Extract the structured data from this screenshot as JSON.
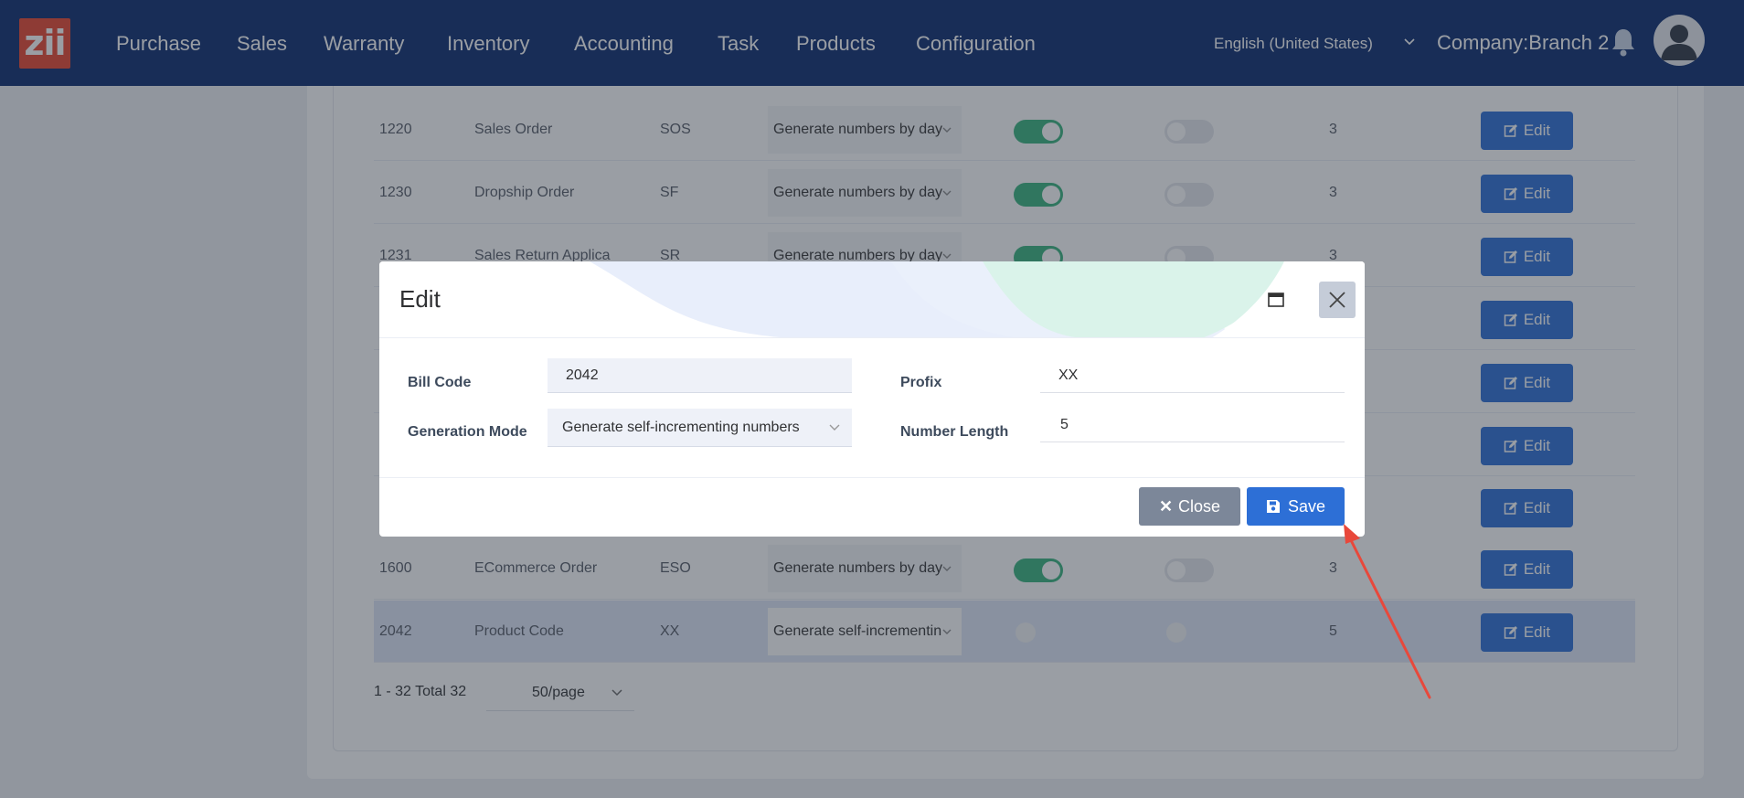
{
  "navbar": {
    "logo_text": "zii",
    "items": [
      "Purchase",
      "Sales",
      "Warranty",
      "Inventory",
      "Accounting",
      "Task",
      "Products",
      "Configuration"
    ],
    "language": "English (United States)",
    "company": "Company:Branch 2"
  },
  "table": {
    "rows": [
      {
        "code": "1220",
        "name": "Sales Order",
        "prefix": "SOS",
        "mode": "Generate numbers by day",
        "toggle1": "on",
        "toggle2": "off",
        "length": "3"
      },
      {
        "code": "1230",
        "name": "Dropship Order",
        "prefix": "SF",
        "mode": "Generate numbers by day",
        "toggle1": "on",
        "toggle2": "off",
        "length": "3"
      },
      {
        "code": "1231",
        "name": "Sales Return Applica",
        "prefix": "SR",
        "mode": "Generate numbers by day",
        "toggle1": "on",
        "toggle2": "off",
        "length": "3"
      },
      {
        "code": "1600",
        "name": "ECommerce Order",
        "prefix": "ESO",
        "mode": "Generate numbers by day",
        "toggle1": "on",
        "toggle2": "off",
        "length": "3"
      },
      {
        "code": "2042",
        "name": "Product Code",
        "prefix": "XX",
        "mode": "Generate self-incrementin",
        "toggle1": "none",
        "toggle2": "none",
        "length": "5"
      }
    ],
    "edit_label": "Edit"
  },
  "pagination": {
    "summary": "1 - 32 Total 32",
    "page_size": "50/page"
  },
  "modal": {
    "title": "Edit",
    "fields": {
      "bill_code_label": "Bill Code",
      "bill_code_value": "2042",
      "profix_label": "Profix",
      "profix_value": "XX",
      "generation_mode_label": "Generation Mode",
      "generation_mode_value": "Generate self-incrementing numbers",
      "number_length_label": "Number Length",
      "number_length_value": "5"
    },
    "close_label": "Close",
    "save_label": "Save"
  },
  "colors": {
    "navbar": "#0a2a6e",
    "primary": "#2d6fd6",
    "toggle_on": "#37b37e",
    "logo": "#e8442e",
    "annotation_arrow": "#e8483b"
  }
}
